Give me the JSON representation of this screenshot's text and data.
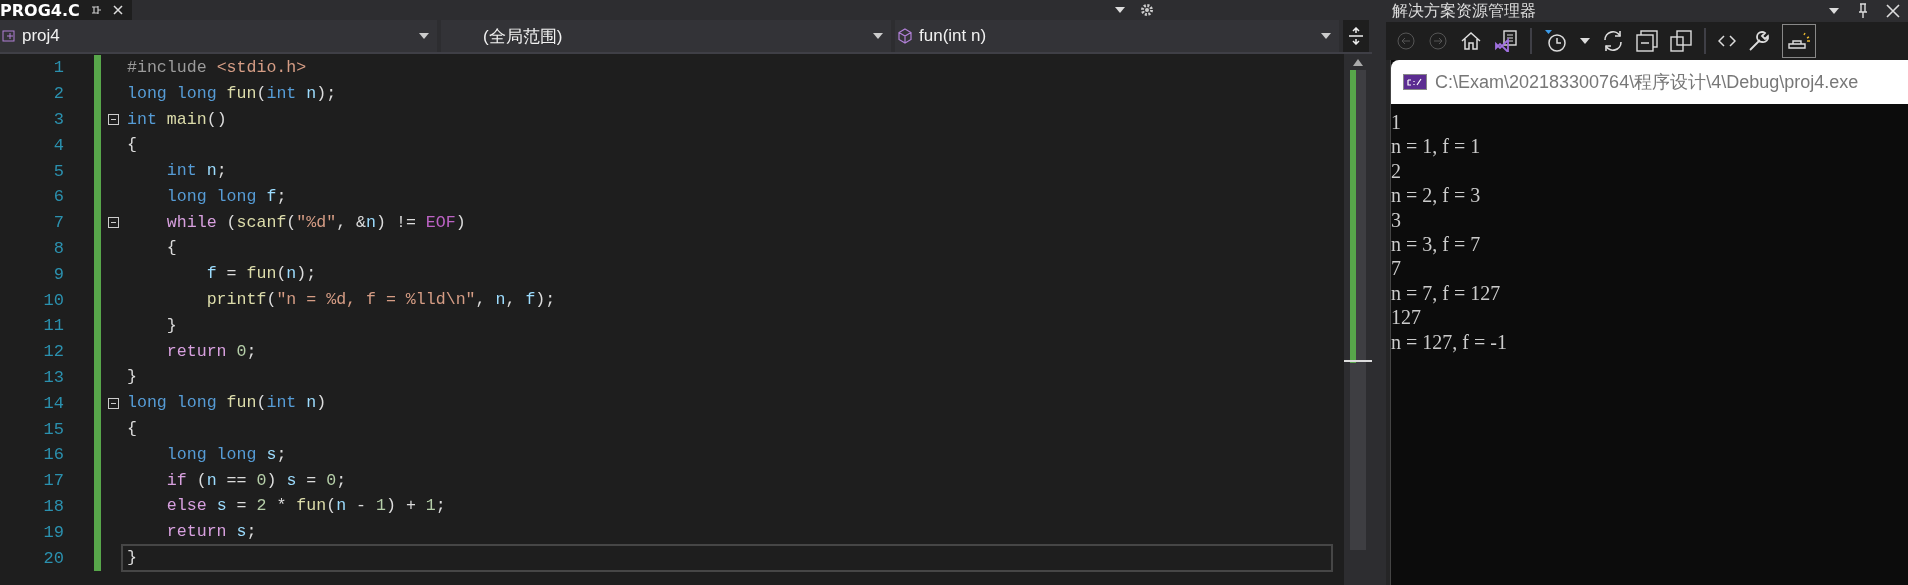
{
  "editor_tab": {
    "title": "PROG4.C",
    "selected": true
  },
  "navigation_bar": {
    "project": "proj4",
    "scope": "(全局范围)",
    "member": "fun(int n)"
  },
  "code_lines": [
    {
      "number": "1",
      "fold": false,
      "current": false,
      "tokens": [
        {
          "kind": "pp",
          "text": "#include "
        },
        {
          "kind": "inc",
          "text": "<stdio.h>"
        }
      ]
    },
    {
      "number": "2",
      "fold": false,
      "current": false,
      "tokens": [
        {
          "kind": "kw",
          "text": "long long "
        },
        {
          "kind": "fn",
          "text": "fun"
        },
        {
          "kind": "pl",
          "text": "("
        },
        {
          "kind": "kw",
          "text": "int "
        },
        {
          "kind": "var",
          "text": "n"
        },
        {
          "kind": "pl",
          "text": ");"
        }
      ]
    },
    {
      "number": "3",
      "fold": true,
      "current": false,
      "tokens": [
        {
          "kind": "kw",
          "text": "int "
        },
        {
          "kind": "fn",
          "text": "main"
        },
        {
          "kind": "pl",
          "text": "()"
        }
      ]
    },
    {
      "number": "4",
      "fold": false,
      "current": false,
      "tokens": [
        {
          "kind": "pl",
          "text": "{"
        }
      ]
    },
    {
      "number": "5",
      "fold": false,
      "current": false,
      "tokens": [
        {
          "kind": "kw",
          "text": "    int "
        },
        {
          "kind": "var",
          "text": "n"
        },
        {
          "kind": "pl",
          "text": ";"
        }
      ]
    },
    {
      "number": "6",
      "fold": false,
      "current": false,
      "tokens": [
        {
          "kind": "kw",
          "text": "    long long "
        },
        {
          "kind": "var",
          "text": "f"
        },
        {
          "kind": "pl",
          "text": ";"
        }
      ]
    },
    {
      "number": "7",
      "fold": true,
      "current": false,
      "tokens": [
        {
          "kind": "ctl",
          "text": "    while "
        },
        {
          "kind": "pl",
          "text": "("
        },
        {
          "kind": "fn",
          "text": "scanf"
        },
        {
          "kind": "pl",
          "text": "("
        },
        {
          "kind": "str",
          "text": "\"%d\""
        },
        {
          "kind": "pl",
          "text": ", &"
        },
        {
          "kind": "var",
          "text": "n"
        },
        {
          "kind": "pl",
          "text": ") != "
        },
        {
          "kind": "mac",
          "text": "EOF"
        },
        {
          "kind": "pl",
          "text": ")"
        }
      ]
    },
    {
      "number": "8",
      "fold": false,
      "current": false,
      "tokens": [
        {
          "kind": "pl",
          "text": "    {"
        }
      ]
    },
    {
      "number": "9",
      "fold": false,
      "current": false,
      "tokens": [
        {
          "kind": "var",
          "text": "        f"
        },
        {
          "kind": "pl",
          "text": " = "
        },
        {
          "kind": "fn",
          "text": "fun"
        },
        {
          "kind": "pl",
          "text": "("
        },
        {
          "kind": "var",
          "text": "n"
        },
        {
          "kind": "pl",
          "text": ");"
        }
      ]
    },
    {
      "number": "10",
      "fold": false,
      "current": false,
      "tokens": [
        {
          "kind": "fn",
          "text": "        printf"
        },
        {
          "kind": "pl",
          "text": "("
        },
        {
          "kind": "str",
          "text": "\"n = %d, f = %lld\\n\""
        },
        {
          "kind": "pl",
          "text": ", "
        },
        {
          "kind": "var",
          "text": "n"
        },
        {
          "kind": "pl",
          "text": ", "
        },
        {
          "kind": "var",
          "text": "f"
        },
        {
          "kind": "pl",
          "text": ");"
        }
      ]
    },
    {
      "number": "11",
      "fold": false,
      "current": false,
      "tokens": [
        {
          "kind": "pl",
          "text": "    }"
        }
      ]
    },
    {
      "number": "12",
      "fold": false,
      "current": false,
      "tokens": [
        {
          "kind": "ctl",
          "text": "    return "
        },
        {
          "kind": "num",
          "text": "0"
        },
        {
          "kind": "pl",
          "text": ";"
        }
      ]
    },
    {
      "number": "13",
      "fold": false,
      "current": false,
      "tokens": [
        {
          "kind": "pl",
          "text": "}"
        }
      ]
    },
    {
      "number": "14",
      "fold": true,
      "current": false,
      "tokens": [
        {
          "kind": "kw",
          "text": "long long "
        },
        {
          "kind": "fn",
          "text": "fun"
        },
        {
          "kind": "pl",
          "text": "("
        },
        {
          "kind": "kw",
          "text": "int "
        },
        {
          "kind": "var",
          "text": "n"
        },
        {
          "kind": "pl",
          "text": ")"
        }
      ]
    },
    {
      "number": "15",
      "fold": false,
      "current": false,
      "tokens": [
        {
          "kind": "pl",
          "text": "{"
        }
      ]
    },
    {
      "number": "16",
      "fold": false,
      "current": false,
      "tokens": [
        {
          "kind": "kw",
          "text": "    long long "
        },
        {
          "kind": "var",
          "text": "s"
        },
        {
          "kind": "pl",
          "text": ";"
        }
      ]
    },
    {
      "number": "17",
      "fold": false,
      "current": false,
      "tokens": [
        {
          "kind": "ctl",
          "text": "    if "
        },
        {
          "kind": "pl",
          "text": "("
        },
        {
          "kind": "var",
          "text": "n"
        },
        {
          "kind": "pl",
          "text": " == "
        },
        {
          "kind": "num",
          "text": "0"
        },
        {
          "kind": "pl",
          "text": ") "
        },
        {
          "kind": "var",
          "text": "s"
        },
        {
          "kind": "pl",
          "text": " = "
        },
        {
          "kind": "num",
          "text": "0"
        },
        {
          "kind": "pl",
          "text": ";"
        }
      ]
    },
    {
      "number": "18",
      "fold": false,
      "current": false,
      "tokens": [
        {
          "kind": "ctl",
          "text": "    else "
        },
        {
          "kind": "var",
          "text": "s"
        },
        {
          "kind": "pl",
          "text": " = "
        },
        {
          "kind": "num",
          "text": "2"
        },
        {
          "kind": "pl",
          "text": " * "
        },
        {
          "kind": "fn",
          "text": "fun"
        },
        {
          "kind": "pl",
          "text": "("
        },
        {
          "kind": "var",
          "text": "n"
        },
        {
          "kind": "pl",
          "text": " - "
        },
        {
          "kind": "num",
          "text": "1"
        },
        {
          "kind": "pl",
          "text": ") + "
        },
        {
          "kind": "num",
          "text": "1"
        },
        {
          "kind": "pl",
          "text": ";"
        }
      ]
    },
    {
      "number": "19",
      "fold": false,
      "current": false,
      "tokens": [
        {
          "kind": "ctl",
          "text": "    return "
        },
        {
          "kind": "var",
          "text": "s"
        },
        {
          "kind": "pl",
          "text": ";"
        }
      ]
    },
    {
      "number": "20",
      "fold": false,
      "current": true,
      "tokens": [
        {
          "kind": "pl",
          "text": "}"
        }
      ]
    }
  ],
  "solution_explorer": {
    "title": "解决方案资源管理器"
  },
  "console": {
    "title": "C:\\Exam\\202183300764\\程序设计\\4\\Debug\\proj4.exe",
    "lines": [
      "1",
      "n = 1, f = 1",
      "2",
      "n = 2, f = 3",
      "3",
      "n = 3, f = 7",
      "7",
      "n = 7, f = 127",
      "127",
      "n = 127, f = -1"
    ]
  }
}
